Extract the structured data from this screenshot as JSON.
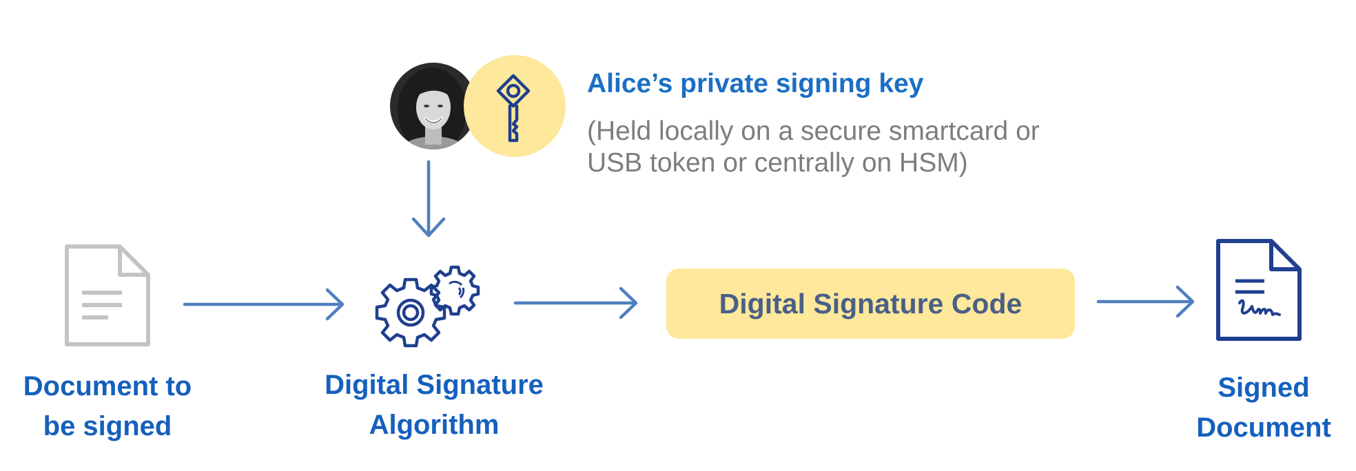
{
  "key_holder": {
    "title": "Alice’s private signing key",
    "note_line1": "(Held locally on a secure smartcard or",
    "note_line2": "USB token or centrally on HSM)"
  },
  "nodes": {
    "document": {
      "line1": "Document to",
      "line2": "be signed"
    },
    "algorithm": {
      "line1": "Digital Signature",
      "line2": "Algorithm"
    },
    "signature_code": {
      "label": "Digital Signature Code"
    },
    "signed": {
      "line1": "Signed",
      "line2": "Document"
    }
  },
  "colors": {
    "arrow": "#4f7fbf",
    "label_blue": "#1560bd",
    "key_title": "#1a6fc4",
    "note_gray": "#7d7d7d",
    "highlight_yellow": "#fde89b",
    "icon_dark_blue": "#1f3f8f",
    "doc_gray": "#c4c4c4"
  },
  "icons": {
    "person": "avatar-photo",
    "key": "key-icon",
    "document": "document-icon",
    "gears": "gears-icon",
    "signed_document": "signed-document-icon"
  }
}
